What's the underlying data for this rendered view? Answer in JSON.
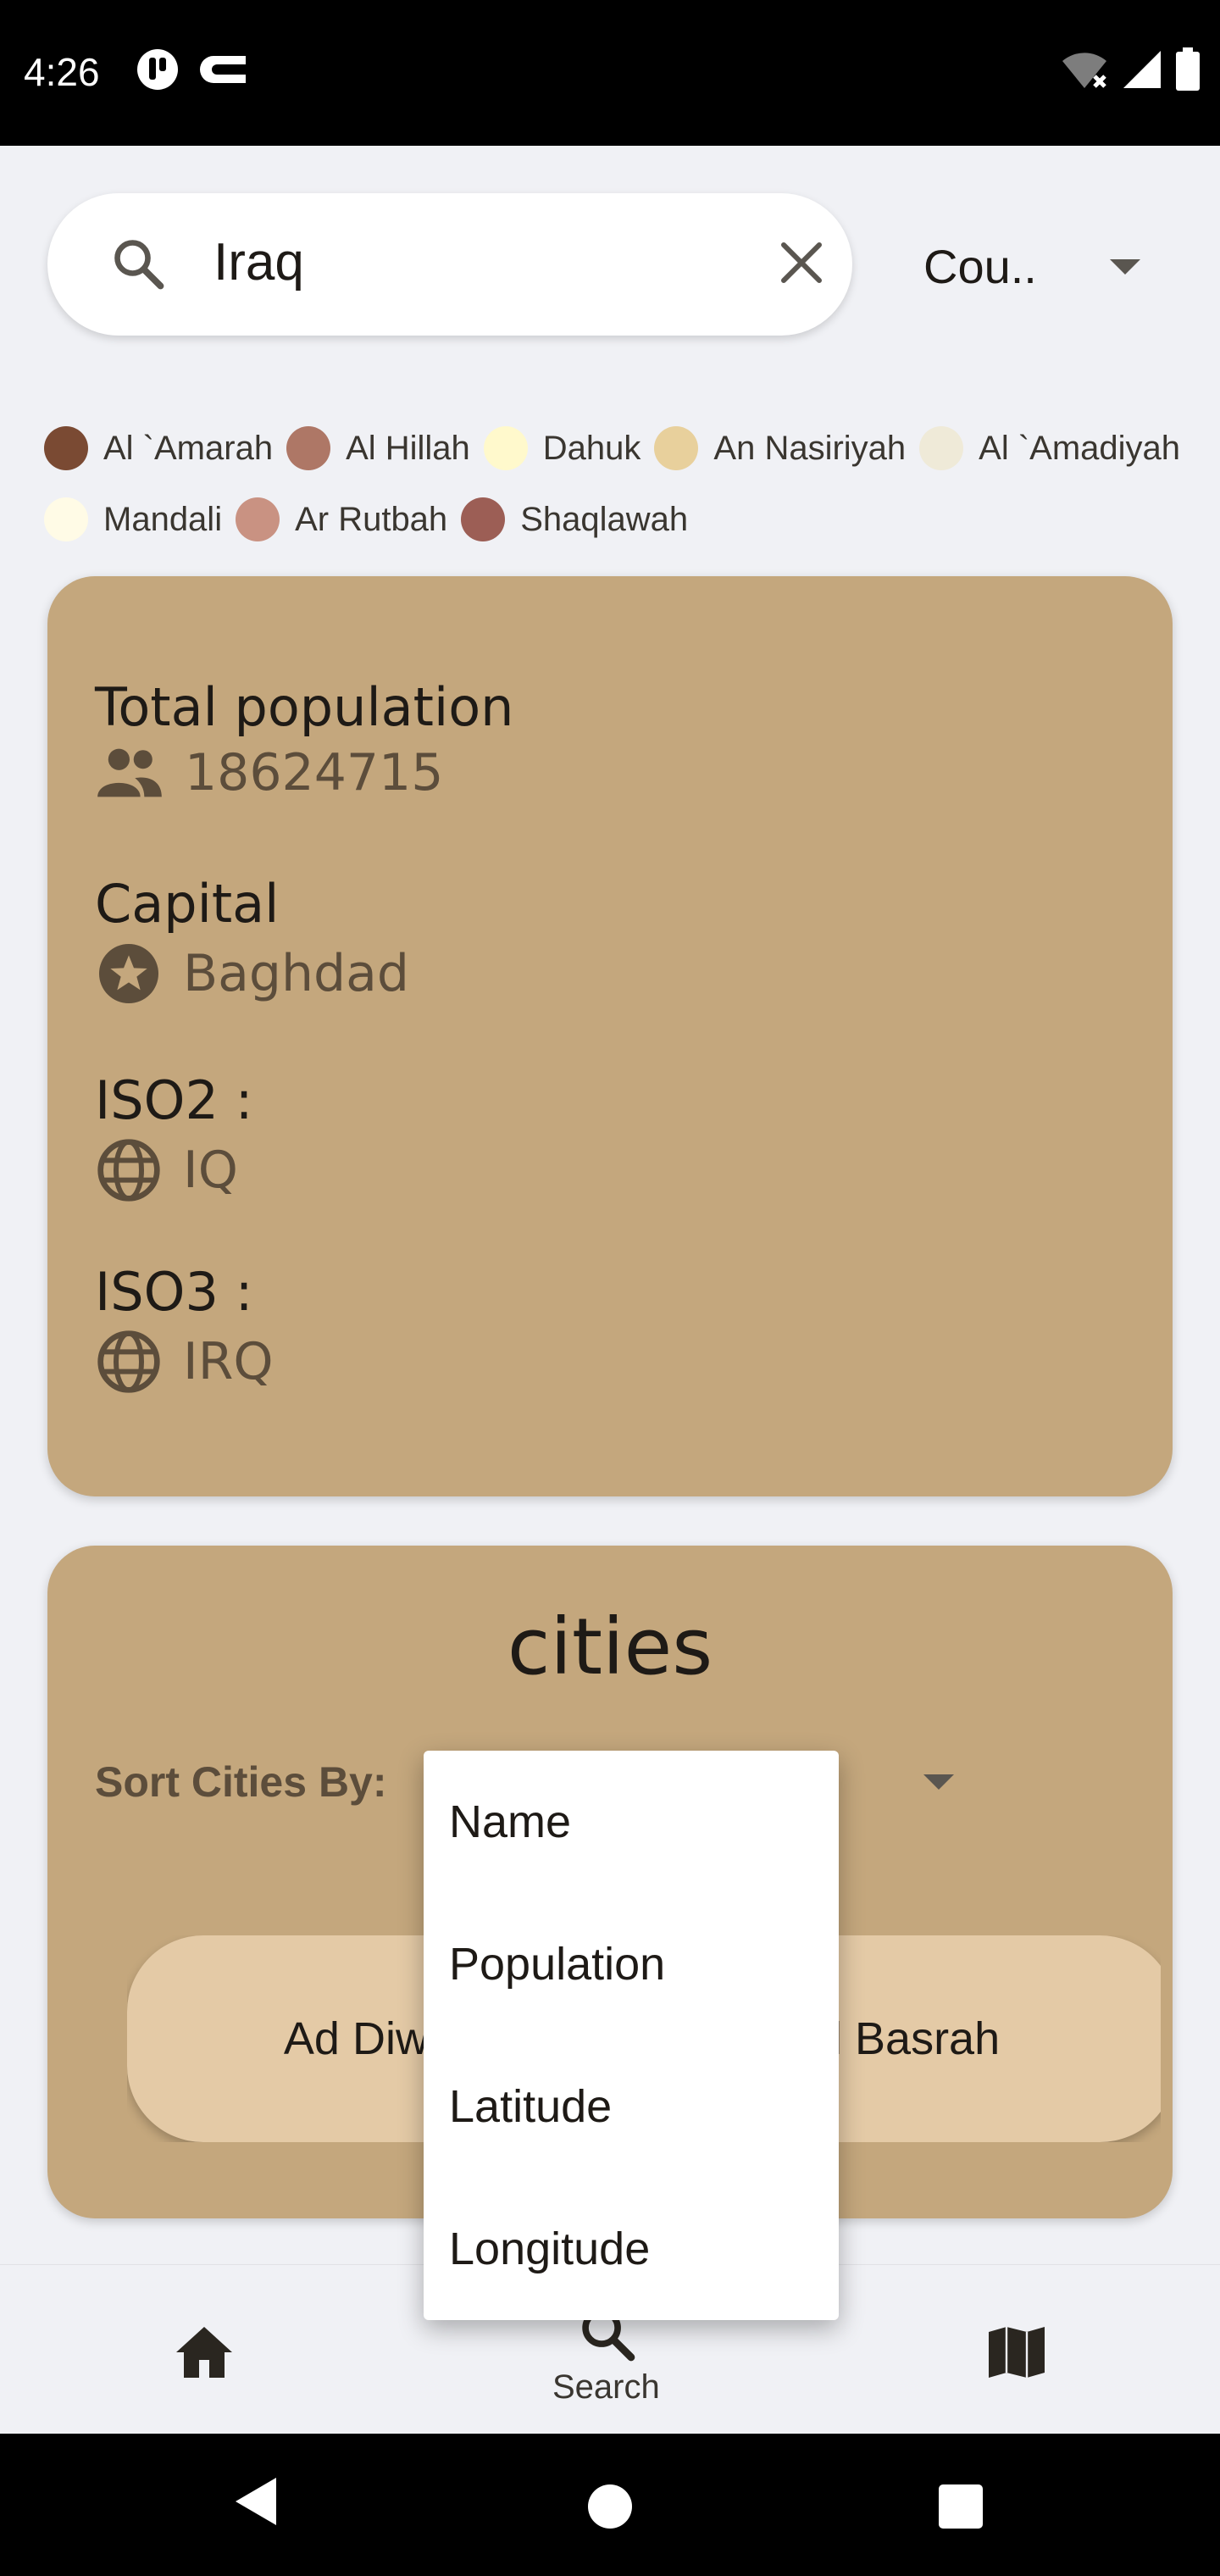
{
  "status_bar": {
    "time": "4:26",
    "icons": [
      "vpn-icon",
      "cast-icon",
      "wifi-off-icon",
      "signal-icon",
      "battery-icon"
    ]
  },
  "search": {
    "value": "Iraq",
    "placeholder": "",
    "search_icon": "search-icon",
    "clear_icon": "close-icon"
  },
  "filter_dropdown": {
    "selected": "Cou.."
  },
  "legend": {
    "rows": [
      [
        {
          "label": "Al `Amarah",
          "color": "#7a4a33"
        },
        {
          "label": "Al Hillah",
          "color": "#ae7766"
        },
        {
          "label": "Dahuk",
          "color": "#fff9cc"
        },
        {
          "label": "An Nasiriyah",
          "color": "#e8d09c"
        },
        {
          "label": "Al `Amadiyah",
          "color": "#efead8"
        }
      ],
      [
        {
          "label": "Mandali",
          "color": "#fffbe6"
        },
        {
          "label": "Ar Rutbah",
          "color": "#c99282"
        },
        {
          "label": "Shaqlawah",
          "color": "#9c5e55"
        }
      ]
    ]
  },
  "country_info": {
    "population_label": "Total population",
    "population_value": "18624715",
    "capital_label": "Capital",
    "capital_value": "Baghdad",
    "iso2_label": "ISO2 :",
    "iso2_value": "IQ",
    "iso3_label": "ISO3 :",
    "iso3_value": "IRQ"
  },
  "cities": {
    "title": "cities",
    "sort_label": "Sort Cities By:",
    "chips": [
      "Ad Diwaniyah",
      "Al Basrah"
    ]
  },
  "sort_menu": {
    "options": [
      "Name",
      "Population",
      "Latitude",
      "Longitude"
    ]
  },
  "bottom_nav": {
    "items": [
      {
        "icon": "home-icon",
        "label": ""
      },
      {
        "icon": "search-icon",
        "label": "Search"
      },
      {
        "icon": "map-icon",
        "label": ""
      }
    ]
  },
  "colors": {
    "card": "#c4a77d",
    "chip": "#e4caa6",
    "background": "#f0f1f5"
  }
}
